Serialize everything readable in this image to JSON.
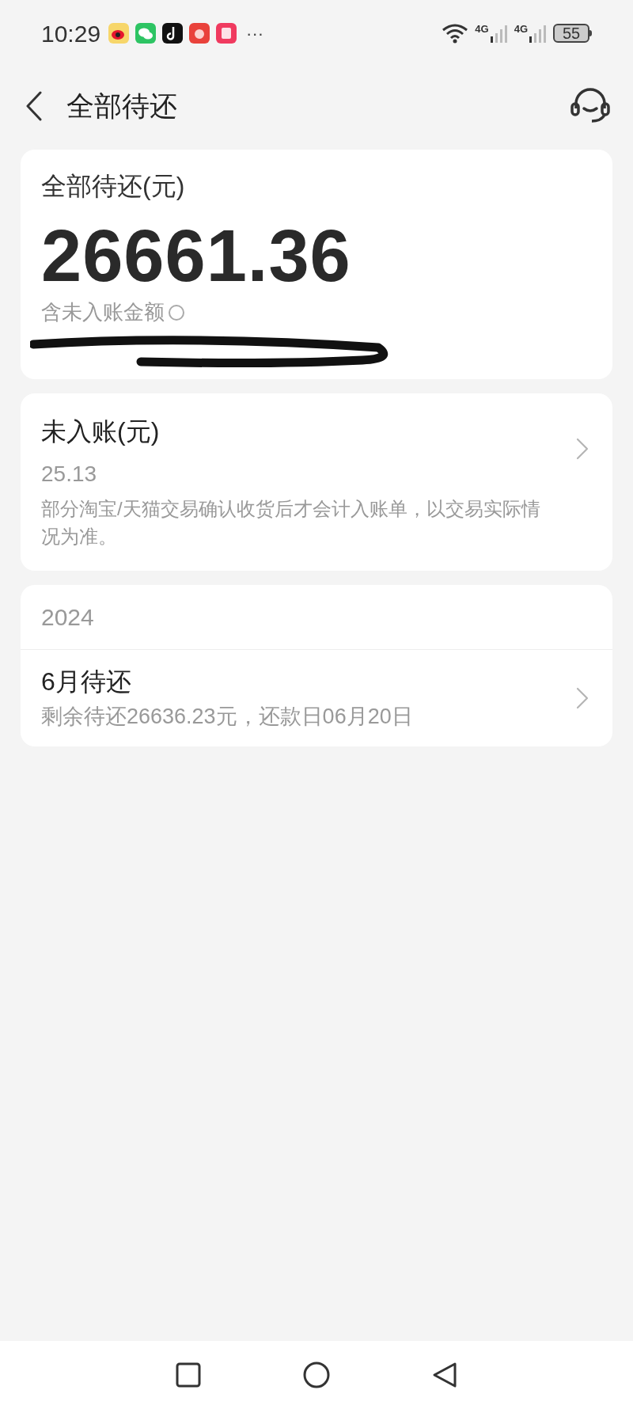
{
  "status_bar": {
    "time": "10:29",
    "more": "···",
    "network_1": "4G",
    "network_2": "4G",
    "battery": "55"
  },
  "header": {
    "title": "全部待还"
  },
  "total_card": {
    "label": "全部待还(元)",
    "amount": "26661.36",
    "note": "含未入账金额"
  },
  "pending_card": {
    "title": "未入账(元)",
    "amount": "25.13",
    "description": "部分淘宝/天猫交易确认收货后才会计入账单，以交易实际情况为准。"
  },
  "bills": {
    "year": "2024",
    "items": [
      {
        "title": "6月待还",
        "detail": "剩余待还26636.23元，还款日06月20日"
      }
    ]
  }
}
